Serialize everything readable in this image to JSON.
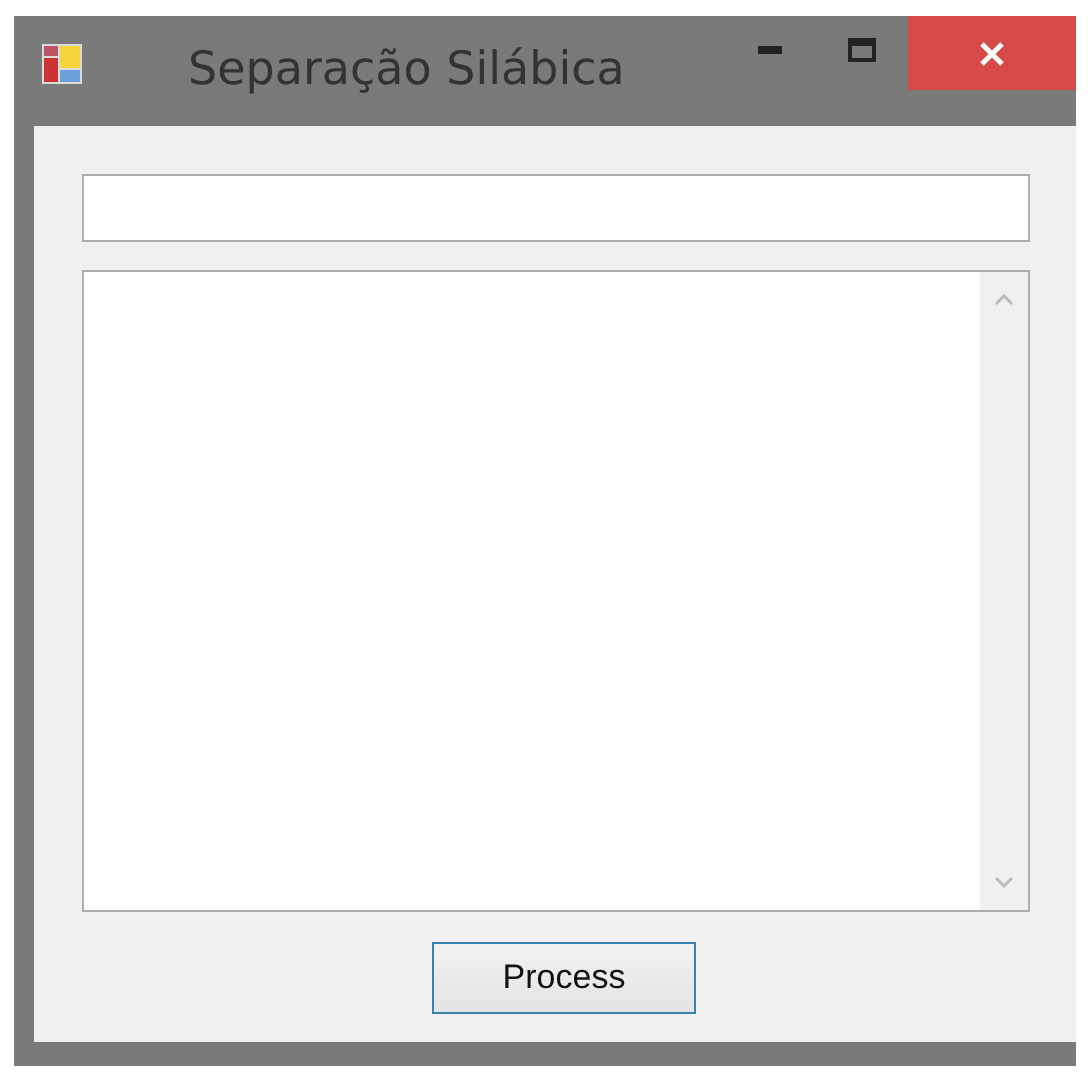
{
  "window": {
    "title": "Separação Silábica"
  },
  "button": {
    "label": "Process"
  }
}
